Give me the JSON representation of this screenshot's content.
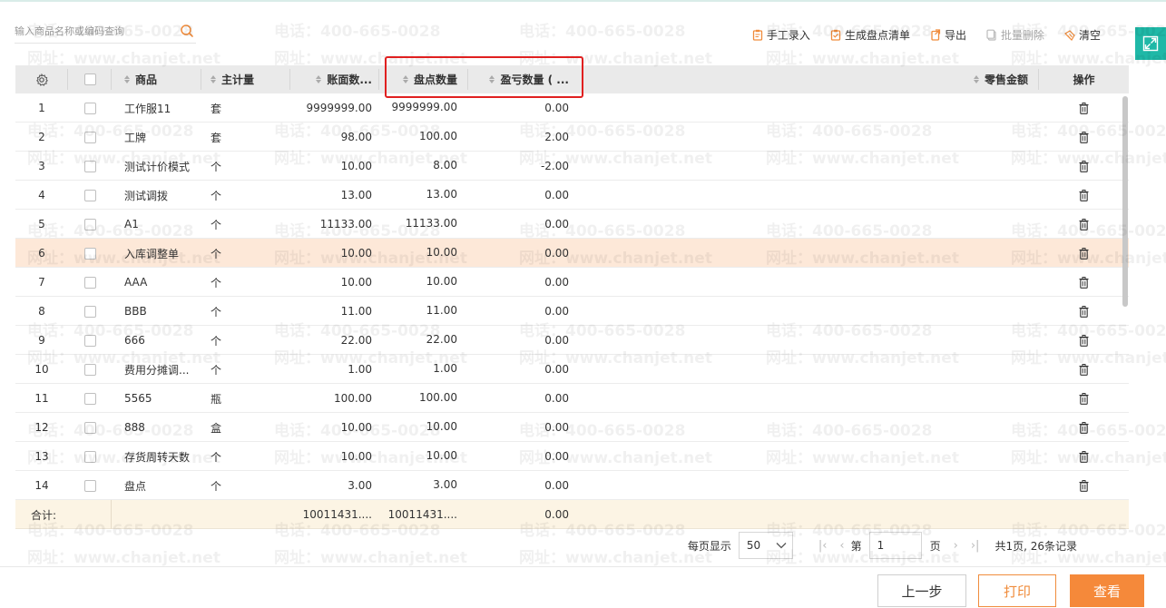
{
  "search": {
    "placeholder": "输入商品名称或编码查询"
  },
  "toolbar": [
    {
      "label": "手工录入",
      "icon": "clipboard-icon",
      "enabled": true
    },
    {
      "label": "生成盘点清单",
      "icon": "clipboard-check-icon",
      "enabled": true
    },
    {
      "label": "导出",
      "icon": "export-icon",
      "enabled": true
    },
    {
      "label": "批量删除",
      "icon": "batch-delete-icon",
      "enabled": false
    },
    {
      "label": "清空",
      "icon": "broom-icon",
      "enabled": true
    }
  ],
  "table": {
    "columns": {
      "product": "商品",
      "unit": "主计量",
      "book_qty": "账面数...",
      "count_qty": "盘点数量",
      "diff_qty": "盈亏数量 ( ...",
      "retail": "零售金额",
      "op": "操作"
    },
    "rows": [
      {
        "idx": "1",
        "product": "工作服11",
        "unit": "套",
        "book": "9999999.00",
        "count": "9999999.00",
        "diff": "0.00"
      },
      {
        "idx": "2",
        "product": "工牌",
        "unit": "套",
        "book": "98.00",
        "count": "100.00",
        "diff": "2.00"
      },
      {
        "idx": "3",
        "product": "测试计价模式",
        "unit": "个",
        "book": "10.00",
        "count": "8.00",
        "diff": "-2.00"
      },
      {
        "idx": "4",
        "product": "测试调拨",
        "unit": "个",
        "book": "13.00",
        "count": "13.00",
        "diff": "0.00"
      },
      {
        "idx": "5",
        "product": "A1",
        "unit": "个",
        "book": "11133.00",
        "count": "11133.00",
        "diff": "0.00"
      },
      {
        "idx": "6",
        "product": "入库调整单",
        "unit": "个",
        "book": "10.00",
        "count": "10.00",
        "diff": "0.00"
      },
      {
        "idx": "7",
        "product": "AAA",
        "unit": "个",
        "book": "10.00",
        "count": "10.00",
        "diff": "0.00"
      },
      {
        "idx": "8",
        "product": "BBB",
        "unit": "个",
        "book": "11.00",
        "count": "11.00",
        "diff": "0.00"
      },
      {
        "idx": "9",
        "product": "666",
        "unit": "个",
        "book": "22.00",
        "count": "22.00",
        "diff": "0.00"
      },
      {
        "idx": "10",
        "product": "费用分摊调...",
        "unit": "个",
        "book": "1.00",
        "count": "1.00",
        "diff": "0.00"
      },
      {
        "idx": "11",
        "product": "5565",
        "unit": "瓶",
        "book": "100.00",
        "count": "100.00",
        "diff": "0.00"
      },
      {
        "idx": "12",
        "product": "888",
        "unit": "盒",
        "book": "10.00",
        "count": "10.00",
        "diff": "0.00"
      },
      {
        "idx": "13",
        "product": "存货周转天数",
        "unit": "个",
        "book": "10.00",
        "count": "10.00",
        "diff": "0.00"
      },
      {
        "idx": "14",
        "product": "盘点",
        "unit": "个",
        "book": "3.00",
        "count": "3.00",
        "diff": "0.00"
      }
    ],
    "highlighted_row": 6,
    "summary": {
      "label": "合计:",
      "book": "10011431....",
      "count": "10011431....",
      "diff": "0.00"
    }
  },
  "pagination": {
    "per_page_label": "每页显示",
    "per_page": "50",
    "page_prefix": "第",
    "page": "1",
    "page_suffix": "页",
    "total": "共1页, 26条记录"
  },
  "footer": {
    "prev": "上一步",
    "print": "打印",
    "view": "查看"
  },
  "watermark": {
    "phone": "电话：400-665-0028",
    "site": "网址：www.chanjet.net"
  },
  "colors": {
    "accent": "#f5893a",
    "teal": "#1fb8a7",
    "highlight_row": "#fde8d8",
    "summary_row": "#fcf4e4",
    "annotation": "#e02020"
  }
}
